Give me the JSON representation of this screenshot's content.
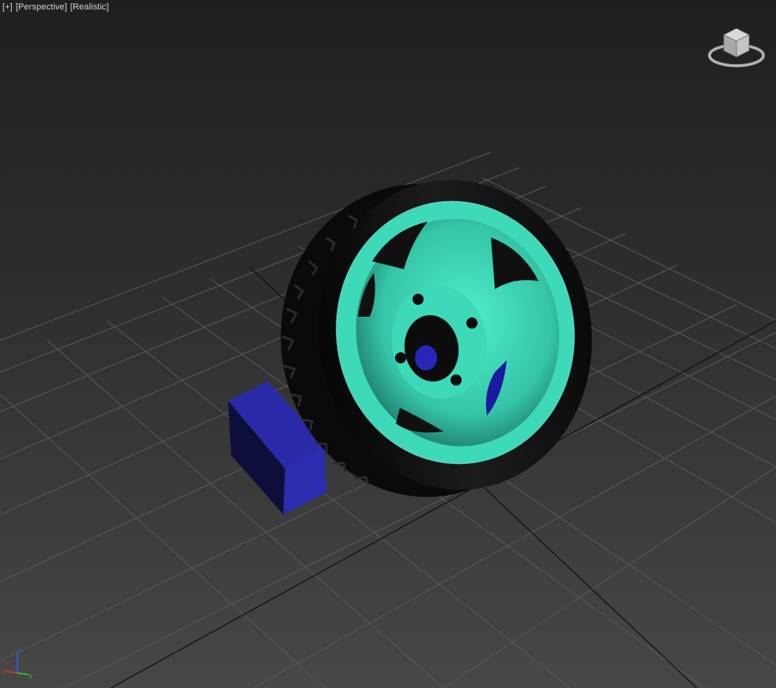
{
  "viewport": {
    "labels": {
      "menu": "[+]",
      "view": "[Perspective]",
      "shading": "[Realistic]"
    },
    "background_top": "#1f1f1f",
    "background_bottom": "#474747"
  },
  "scene": {
    "objects": [
      {
        "name": "wheel-tire",
        "color": "#0f0f0f"
      },
      {
        "name": "wheel-rim",
        "color": "#3ed9b8"
      },
      {
        "name": "motor-block",
        "color": "#2b2ba6"
      }
    ],
    "grid_color": "#5a5a5a",
    "grid_axis_color": "#111111"
  },
  "viewcube": {
    "icon": "viewcube-icon"
  },
  "axis_gizmo": {
    "x_label": "x",
    "y_label": "y",
    "z_label": "z",
    "x_color": "#c83c3c",
    "y_color": "#3cc83c",
    "z_color": "#3c5cff"
  }
}
